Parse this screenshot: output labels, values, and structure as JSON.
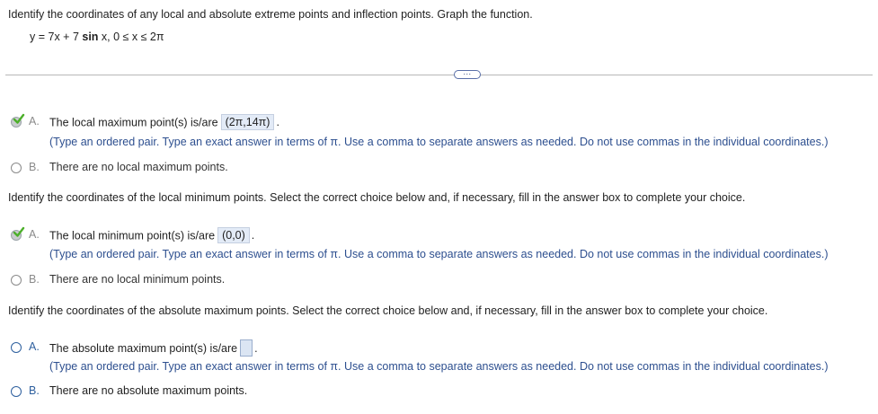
{
  "question": {
    "prompt": "Identify the coordinates of any local and absolute extreme points and inflection points. Graph the function.",
    "formula_prefix": "y = 7x + 7 ",
    "formula_sin": "sin",
    "formula_suffix": " x, 0 ≤ x ≤ 2π"
  },
  "more_button": "⋯",
  "hint_text": "(Type an ordered pair. Type an exact answer in terms of π. Use a comma to separate answers as needed. Do not use commas in the individual coordinates.)",
  "sections": {
    "local_max": {
      "option_a_letter": "A.",
      "option_a_text": "The local maximum point(s) is/are",
      "option_a_answer": "(2π,14π)",
      "option_b_letter": "B.",
      "option_b_text": "There are no local maximum points."
    },
    "local_min": {
      "prompt": "Identify the coordinates of the local minimum points. Select the correct choice below and, if necessary, fill in the answer box to complete your choice.",
      "option_a_letter": "A.",
      "option_a_text": "The local minimum point(s) is/are",
      "option_a_answer": "(0,0)",
      "option_b_letter": "B.",
      "option_b_text": "There are no local minimum points."
    },
    "abs_max": {
      "prompt": "Identify the coordinates of the absolute maximum points. Select the correct choice below and, if necessary, fill in the answer box to complete your choice.",
      "option_a_letter": "A.",
      "option_a_text": "The absolute maximum point(s) is/are",
      "option_a_answer": "",
      "option_b_letter": "B.",
      "option_b_text": "There are no absolute maximum points."
    }
  },
  "colors": {
    "hint": "#2d4f8f",
    "radio_blue": "#2d5f9e",
    "check_green": "#4caf2a",
    "answer_bg": "#e3ebf7"
  }
}
